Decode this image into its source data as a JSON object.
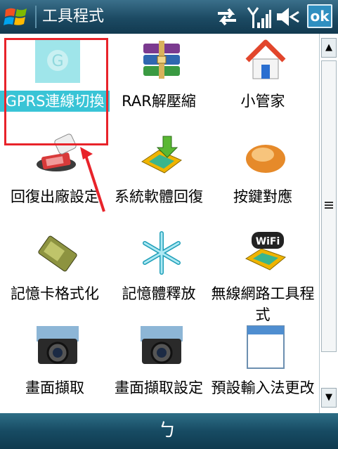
{
  "titlebar": {
    "title": "工具程式",
    "ok_label": "ok"
  },
  "icons": {
    "start": "windows-start-icon",
    "connectivity": "sync-arrows-icon",
    "signal": "signal-strength-icon",
    "volume": "speaker-mute-icon"
  },
  "apps": [
    {
      "label": "GPRS連線切換",
      "icon": "gprs-switch-icon",
      "selected": true
    },
    {
      "label": "RAR解壓縮",
      "icon": "rar-archive-icon"
    },
    {
      "label": "小管家",
      "icon": "house-icon"
    },
    {
      "label": "回復出廠設定",
      "icon": "eraser-reset-icon"
    },
    {
      "label": "系統軟體回復",
      "icon": "device-restore-icon"
    },
    {
      "label": "按鍵對應",
      "icon": "bread-icon"
    },
    {
      "label": "記憶卡格式化",
      "icon": "memory-card-icon"
    },
    {
      "label": "記憶體釋放",
      "icon": "snowflake-icon"
    },
    {
      "label": "無線網路工具程式",
      "icon": "wifi-device-icon"
    },
    {
      "label": "畫面擷取",
      "icon": "camera-icon"
    },
    {
      "label": "畫面擷取設定",
      "icon": "camera-settings-icon"
    },
    {
      "label": "預設輸入法更改",
      "icon": "window-app-icon"
    }
  ],
  "bottombar": {
    "softkey_label": "ㄅ"
  },
  "colors": {
    "selection": "#39c4d6",
    "highlight_box": "#e8232a",
    "titlebar": "#1c4a63"
  }
}
